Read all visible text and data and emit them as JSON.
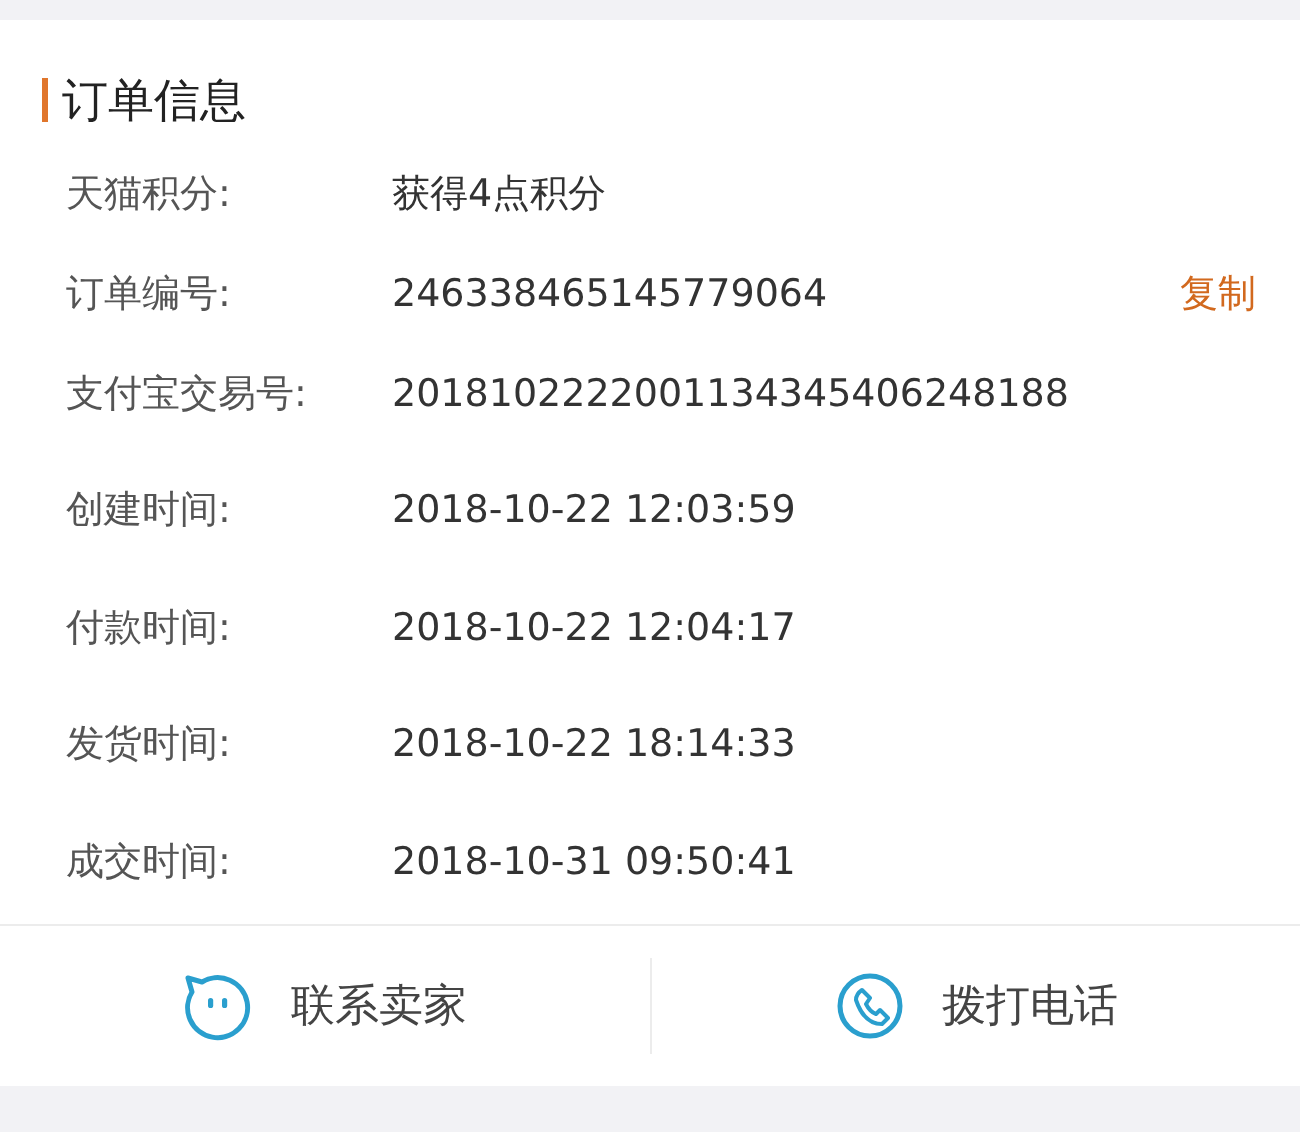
{
  "section": {
    "title": "订单信息"
  },
  "fields": [
    {
      "label": "天猫积分:",
      "value": "获得4点积分"
    },
    {
      "label": "订单编号:",
      "value": "246338465145779064",
      "action": "复制"
    },
    {
      "label": "支付宝交易号:",
      "value": "2018102222001134345406248188"
    },
    {
      "label": "创建时间:",
      "value": "2018-10-22 12:03:59"
    },
    {
      "label": "付款时间:",
      "value": "2018-10-22 12:04:17"
    },
    {
      "label": "发货时间:",
      "value": "2018-10-22 18:14:33"
    },
    {
      "label": "成交时间:",
      "value": "2018-10-31 09:50:41"
    }
  ],
  "footer": [
    {
      "kind": "chat",
      "label": "联系卖家"
    },
    {
      "kind": "phone",
      "label": "拨打电话"
    }
  ]
}
